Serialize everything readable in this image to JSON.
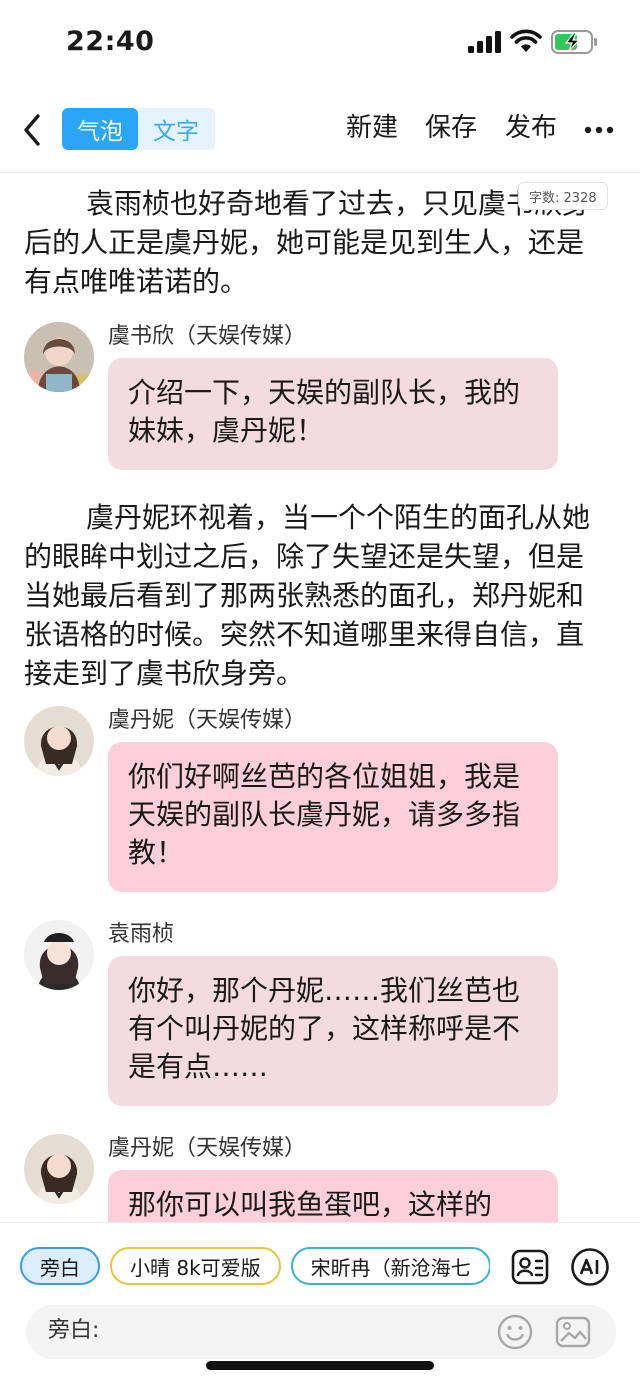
{
  "status_bar": {
    "time": "22:40"
  },
  "header": {
    "modes": [
      {
        "label": "气泡",
        "active": true
      },
      {
        "label": "文字",
        "active": false
      }
    ],
    "actions": {
      "new": "新建",
      "save": "保存",
      "publish": "发布"
    }
  },
  "word_count": "字数: 2328",
  "content": {
    "narration_1": "袁雨桢也好奇地看了过去，只见虞书欣身后的人正是虞丹妮，她可能是见到生人，还是有点唯唯诺诺的。",
    "messages": [
      {
        "speaker": "虞书欣（天娱传媒）",
        "text": "介绍一下，天娱的副队长，我的妹妹，虞丹妮！",
        "avatar_color": "#c7b6a4"
      },
      {
        "speaker": "虞丹妮（天娱传媒）",
        "text": "你们好啊丝芭的各位姐姐，我是天娱的副队长虞丹妮，请多多指教！",
        "avatar_color": "#d9c7b1"
      },
      {
        "speaker": "袁雨桢",
        "text": "你好，那个丹妮……我们丝芭也有个叫丹妮的了，这样称呼是不是有点……",
        "avatar_color": "#4a3c3a"
      },
      {
        "speaker": "虞丹妮（天娱传媒）",
        "text": "那你可以叫我鱼蛋吧，这样的",
        "avatar_color": "#d9c7b1"
      }
    ],
    "narration_2": "虞丹妮环视着，当一个个陌生的面孔从她的眼眸中划过之后，除了失望还是失望，但是当她最后看到了那两张熟悉的面孔，郑丹妮和张语格的时候。突然不知道哪里来得自信，直接走到了虞书欣身旁。"
  },
  "bottom": {
    "roles": [
      "旁白",
      "小晴 8k可爱版",
      "宋昕冉（新沧海七"
    ],
    "input_prefix": "旁白:",
    "input_value": ""
  },
  "colors": {
    "accent": "#29a6f5",
    "bubble_pink": "#fccfdb",
    "bubble_muted": "#f3dbe1"
  }
}
